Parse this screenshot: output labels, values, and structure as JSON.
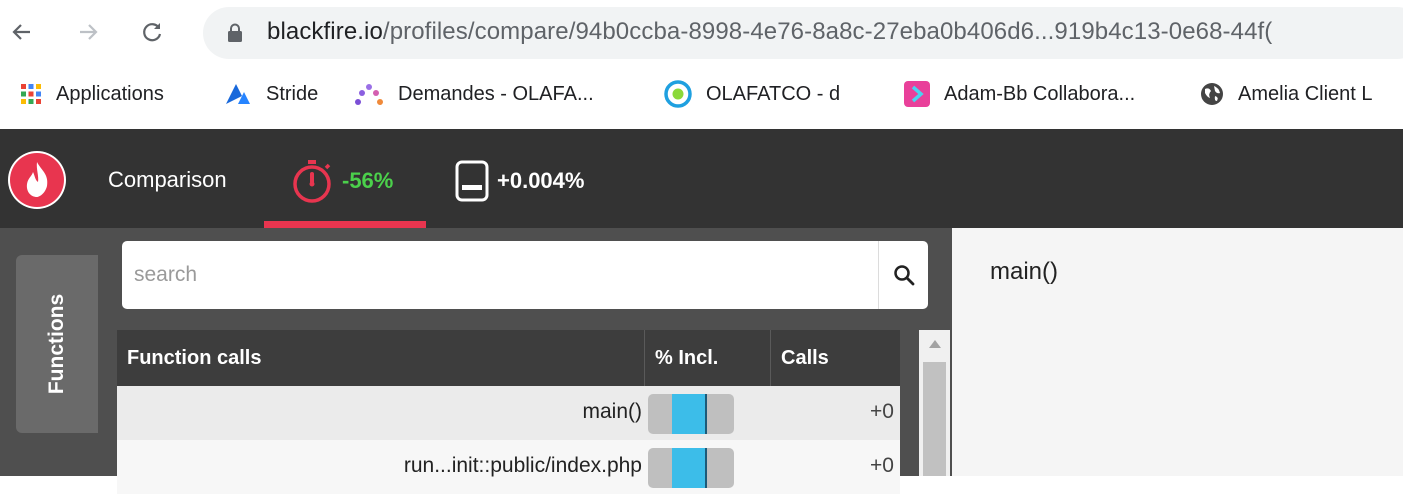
{
  "browser": {
    "url_domain": "blackfire.io",
    "url_path": "/profiles/compare/94b0ccba-8998-4e76-8a8c-27eba0b406d6...919b4c13-0e68-44f("
  },
  "bookmarks": [
    {
      "label": "Applications",
      "icon": "apps-grid-icon"
    },
    {
      "label": "Stride",
      "icon": "stride-icon"
    },
    {
      "label": "Demandes - OLAFA...",
      "icon": "demandes-icon"
    },
    {
      "label": "OLAFATCO - d",
      "icon": "olafatco-icon"
    },
    {
      "label": "Adam-Bb Collabora...",
      "icon": "collabora-icon"
    },
    {
      "label": "Amelia Client L",
      "icon": "globe-icon"
    }
  ],
  "app": {
    "title": "Comparison",
    "metrics": [
      {
        "icon": "stopwatch-icon",
        "value": "-56%",
        "color": "#4bd04b"
      },
      {
        "icon": "memory-icon",
        "value": "+0.004%",
        "color": "#ffffff"
      }
    ],
    "active_tab_color": "#e8354f",
    "side_tab": "Functions"
  },
  "search": {
    "placeholder": "search"
  },
  "table": {
    "headers": [
      "Function calls",
      "% Incl.",
      "Calls"
    ],
    "rows": [
      {
        "name": "main()",
        "incl_fraction": 0.4,
        "calls": "+0"
      },
      {
        "name": "run...init::public/index.php",
        "incl_fraction": 0.4,
        "calls": "+0"
      }
    ]
  },
  "detail": {
    "title": "main()"
  }
}
